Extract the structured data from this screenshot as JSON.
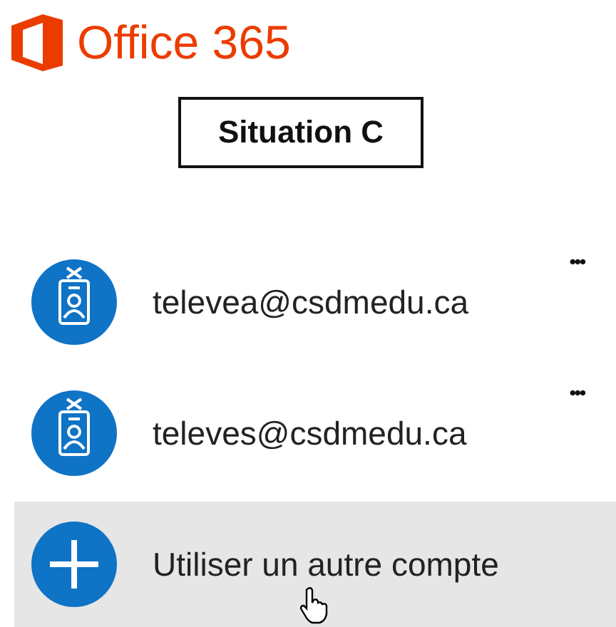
{
  "logo": {
    "text": "Office 365"
  },
  "situation": {
    "label": "Situation C"
  },
  "accounts": [
    {
      "kind": "account",
      "label": "televea@csdmedu.ca",
      "more": "•••",
      "highlighted": false
    },
    {
      "kind": "account",
      "label": "televes@csdmedu.ca",
      "more": "•••",
      "highlighted": false
    },
    {
      "kind": "add",
      "label": "Utiliser un autre compte",
      "highlighted": true
    }
  ]
}
